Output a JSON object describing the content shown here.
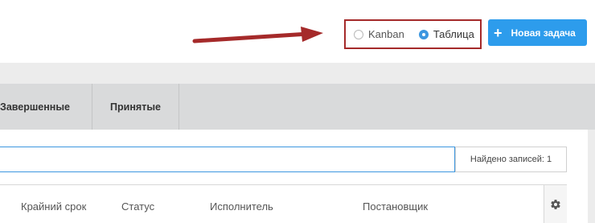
{
  "view_toggle": {
    "options": [
      {
        "label": "Kanban",
        "selected": false
      },
      {
        "label": "Таблица",
        "selected": true
      }
    ]
  },
  "new_task_button": {
    "label": "Новая задача",
    "icon": "plus-icon"
  },
  "tabs": [
    {
      "label": "Завершенные"
    },
    {
      "label": "Принятые"
    }
  ],
  "search": {
    "value": "",
    "placeholder": ""
  },
  "records_count": {
    "label": "Найдено записей: 1"
  },
  "table": {
    "columns": [
      "Крайний срок",
      "Статус",
      "Исполнитель",
      "Постановщик"
    ],
    "settings_icon": "gear-icon"
  },
  "colors": {
    "accent": "#2d9cec",
    "annotation": "#a52a2a",
    "tabs_bg": "#d9dadb"
  }
}
